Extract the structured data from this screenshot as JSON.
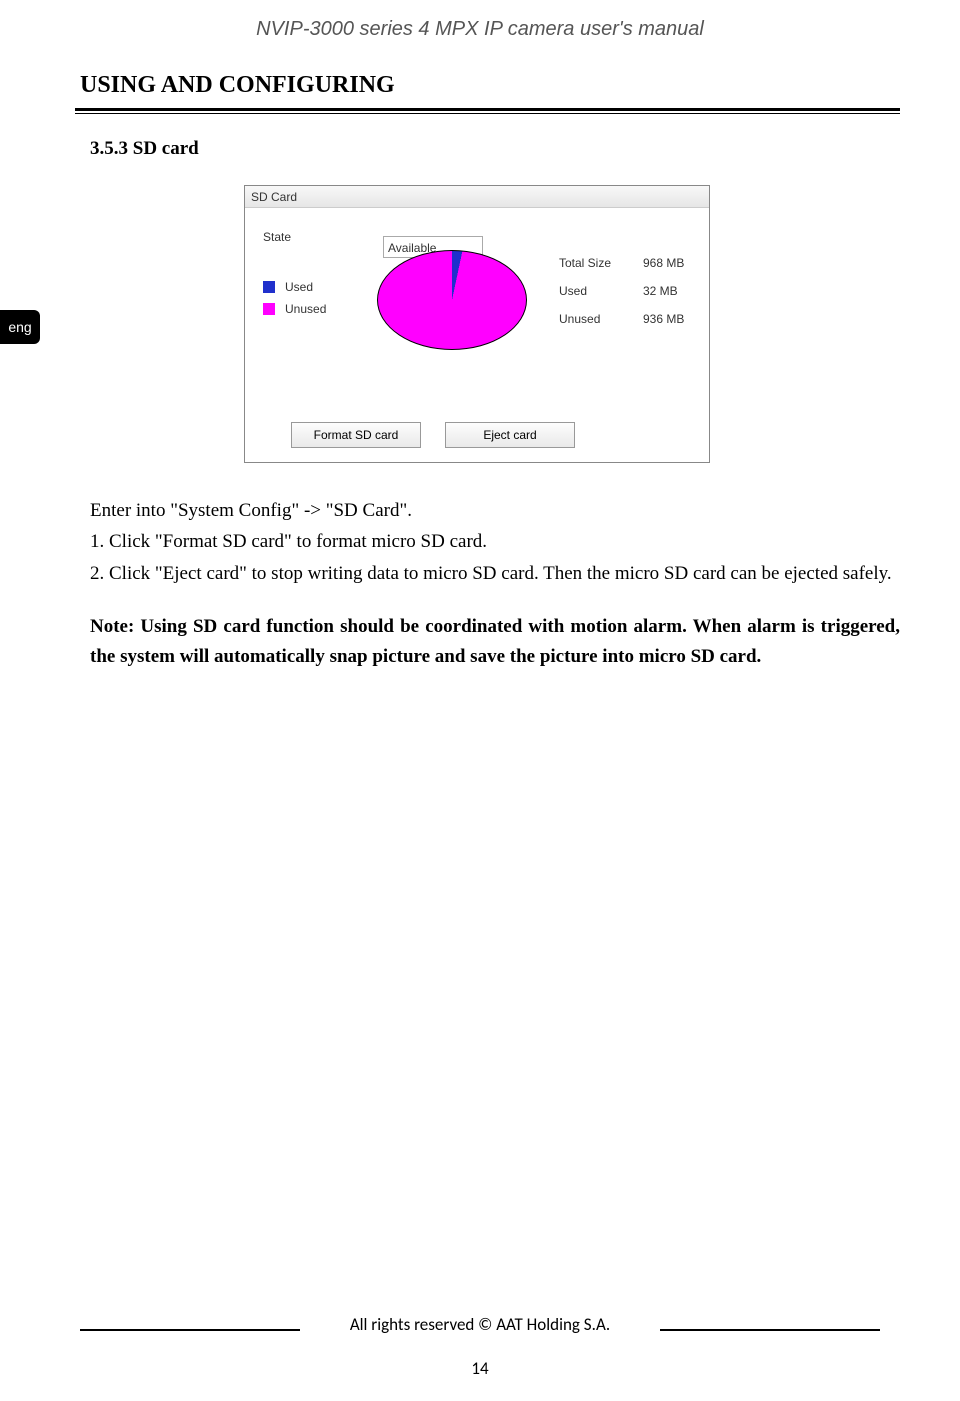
{
  "header_title": "NVIP-3000 series 4 MPX IP camera user's manual",
  "section_heading": "USING AND CONFIGURING",
  "subsection_heading": "3.5.3 SD card",
  "lang_tab": "eng",
  "sdcard": {
    "panel_title": "SD Card",
    "state_label": "State",
    "state_value": "Available",
    "legend_used": "Used",
    "legend_unused": "Unused",
    "stats": {
      "total_label": "Total Size",
      "total_value": "968 MB",
      "used_label": "Used",
      "used_value": "32 MB",
      "unused_label": "Unused",
      "unused_value": "936 MB"
    },
    "btn_format": "Format SD card",
    "btn_eject": "Eject card"
  },
  "chart_data": {
    "type": "pie",
    "title": "SD Card Usage",
    "series": [
      {
        "name": "Used",
        "value": 32,
        "color": "#2030cc"
      },
      {
        "name": "Unused",
        "value": 936,
        "color": "#ff00ff"
      }
    ],
    "total": 968,
    "unit": "MB"
  },
  "body": {
    "p0": "Enter into \"System Config\" -> \"SD Card\".",
    "p1": "1. Click \"Format SD card\" to format micro SD card.",
    "p2": "2. Click \"Eject card\" to stop writing data to micro SD card. Then the micro SD card can be ejected safely.",
    "note": "Note: Using SD card function should be coordinated with motion alarm. When alarm is triggered, the system will automatically snap picture and save the picture into micro SD card."
  },
  "footer_text": "All rights reserved © AAT Holding S.A.",
  "page_number": "14"
}
